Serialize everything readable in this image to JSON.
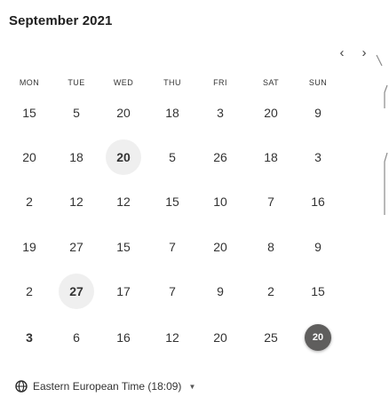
{
  "calendar": {
    "month_title": "September 2021",
    "prev_icon": "chevron-left-icon",
    "next_icon": "chevron-right-icon",
    "weekdays": [
      "MON",
      "TUE",
      "WED",
      "THU",
      "FRI",
      "SAT",
      "SUN"
    ],
    "rows": [
      [
        "15",
        "5",
        "20",
        "18",
        "3",
        "20",
        "9"
      ],
      [
        "20",
        "18",
        "20",
        "5",
        "26",
        "18",
        "3"
      ],
      [
        "2",
        "12",
        "12",
        "15",
        "10",
        "7",
        "16"
      ],
      [
        "19",
        "27",
        "15",
        "7",
        "20",
        "8",
        "9"
      ],
      [
        "2",
        "27",
        "17",
        "7",
        "9",
        "2",
        "15"
      ],
      [
        "3",
        "6",
        "16",
        "12",
        "20",
        "25",
        "20"
      ]
    ],
    "selected_days": [
      "20 (row 2, WED)",
      "27 (row 5, TUE)"
    ],
    "today": "20"
  },
  "timezone": {
    "icon": "globe-icon",
    "label": "Eastern European Time (18:09)",
    "caret_icon": "caret-down-icon"
  },
  "colors": {
    "selected_bg": "#efefef",
    "today_bg": "#5f5e5d"
  }
}
